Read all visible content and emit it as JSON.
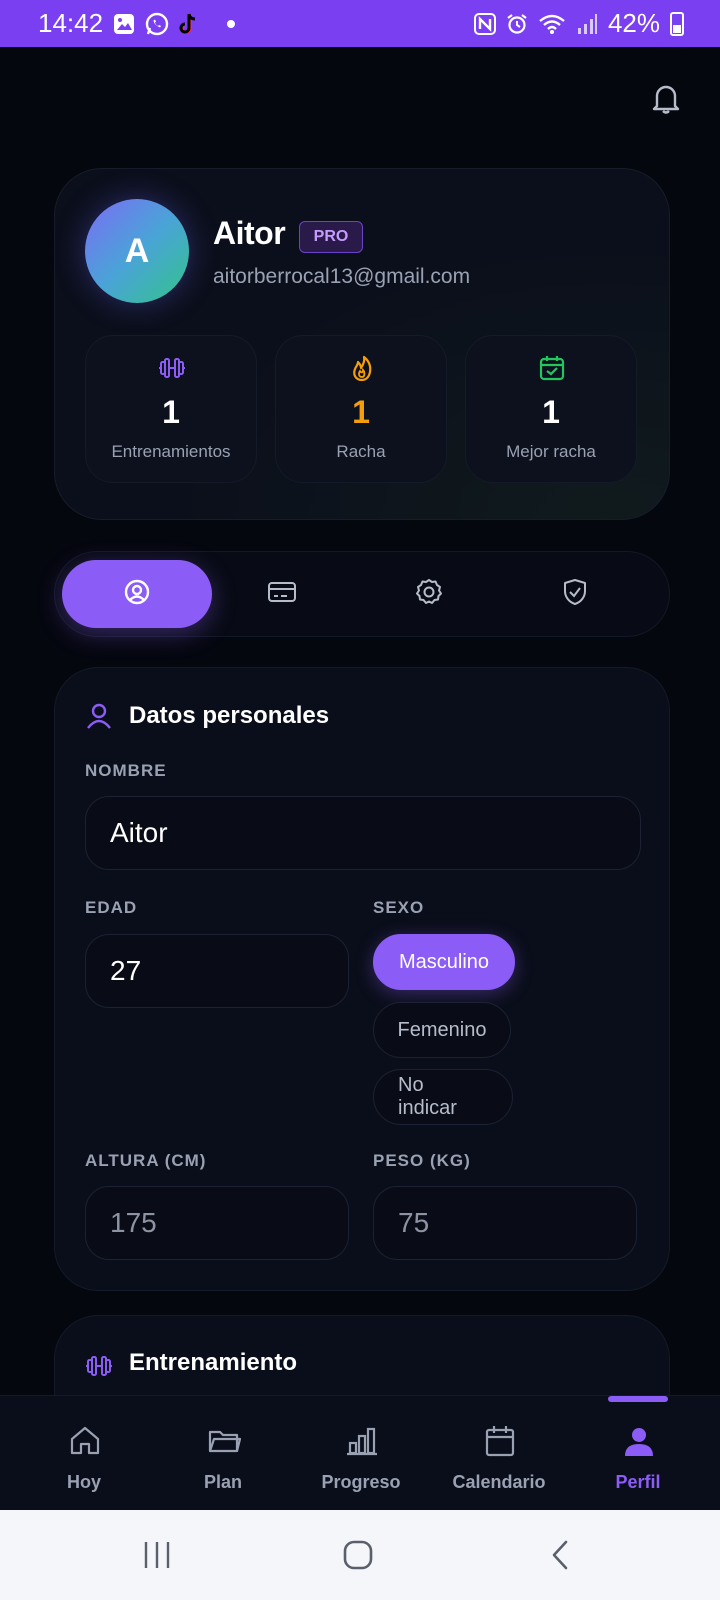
{
  "status_bar": {
    "time": "14:42",
    "battery": "42%",
    "left_icons": [
      "gallery-icon",
      "whatsapp-icon",
      "tiktok-icon"
    ],
    "right_icons": [
      "nfc-icon",
      "alarm-icon",
      "wifi-icon",
      "signal-icon",
      "battery-icon"
    ]
  },
  "colors": {
    "status_bar": "#7a3ff0",
    "accent": "#8b5cf6",
    "background": "#05070f",
    "streak": "#f59e0b",
    "calendar": "#22c55e"
  },
  "profile": {
    "avatar_letter": "A",
    "name": "Aitor",
    "badge": "PRO",
    "email": "aitorberrocal13@gmail.com",
    "stats": [
      {
        "icon": "dumbbell-icon",
        "value": "1",
        "label": "Entrenamientos"
      },
      {
        "icon": "flame-icon",
        "value": "1",
        "label": "Racha"
      },
      {
        "icon": "calendar-check-icon",
        "value": "1",
        "label": "Mejor racha"
      }
    ]
  },
  "tabs": [
    {
      "icon": "user-circle-icon",
      "active": true
    },
    {
      "icon": "credit-card-icon",
      "active": false
    },
    {
      "icon": "settings-icon",
      "active": false
    },
    {
      "icon": "shield-check-icon",
      "active": false
    }
  ],
  "personal": {
    "title": "Datos personales",
    "name_label": "NOMBRE",
    "name_value": "Aitor",
    "age_label": "EDAD",
    "age_value": "27",
    "sex_label": "SEXO",
    "sex_options": [
      "Masculino",
      "Femenino",
      "No indicar"
    ],
    "sex_selected": "Masculino",
    "height_label": "ALTURA (CM)",
    "height_placeholder": "175",
    "weight_label": "PESO (KG)",
    "weight_placeholder": "75"
  },
  "training": {
    "title": "Entrenamiento"
  },
  "bottom_nav": [
    {
      "icon": "home-icon",
      "label": "Hoy"
    },
    {
      "icon": "folder-icon",
      "label": "Plan"
    },
    {
      "icon": "bar-chart-icon",
      "label": "Progreso"
    },
    {
      "icon": "calendar-icon",
      "label": "Calendario"
    },
    {
      "icon": "user-icon",
      "label": "Perfil",
      "active": true
    }
  ]
}
